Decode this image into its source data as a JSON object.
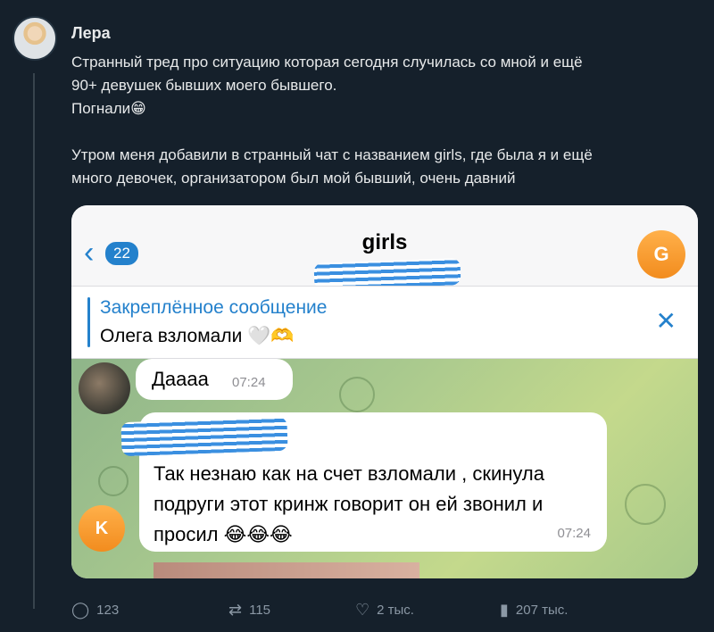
{
  "tweet": {
    "author": "Лера",
    "lines": [
      "Странный тред про ситуацию которая сегодня случилась со мной и ещё",
      "90+ девушек бывших моего бывшего.",
      "Погнали😁",
      "Утром меня добавили в странный чат с названием girls, где была я и ещё",
      "много девочек, организатором был мой бывший, очень давний"
    ]
  },
  "telegram": {
    "back_count": "22",
    "chat_title": "girls",
    "chat_avatar_letter": "G",
    "pinned_title": "Закреплённое сообщение",
    "pinned_text": "Олега взломали 🤍🫶",
    "messages": [
      {
        "text": "Дaaaa",
        "time": "07:24"
      },
      {
        "text": "Так незнаю как на счет взломали , скинула подруги этот кринж говорит он ей звонил и просил 😂😂😂",
        "time": "07:24",
        "avatar_letter": "K"
      }
    ]
  },
  "actions": {
    "replies": "123",
    "retweets": "115",
    "likes": "2 тыс.",
    "views": "207 тыс."
  },
  "icons": {
    "reply": "reply-icon",
    "retweet": "retweet-icon",
    "like": "heart-icon",
    "views": "views-icon"
  }
}
